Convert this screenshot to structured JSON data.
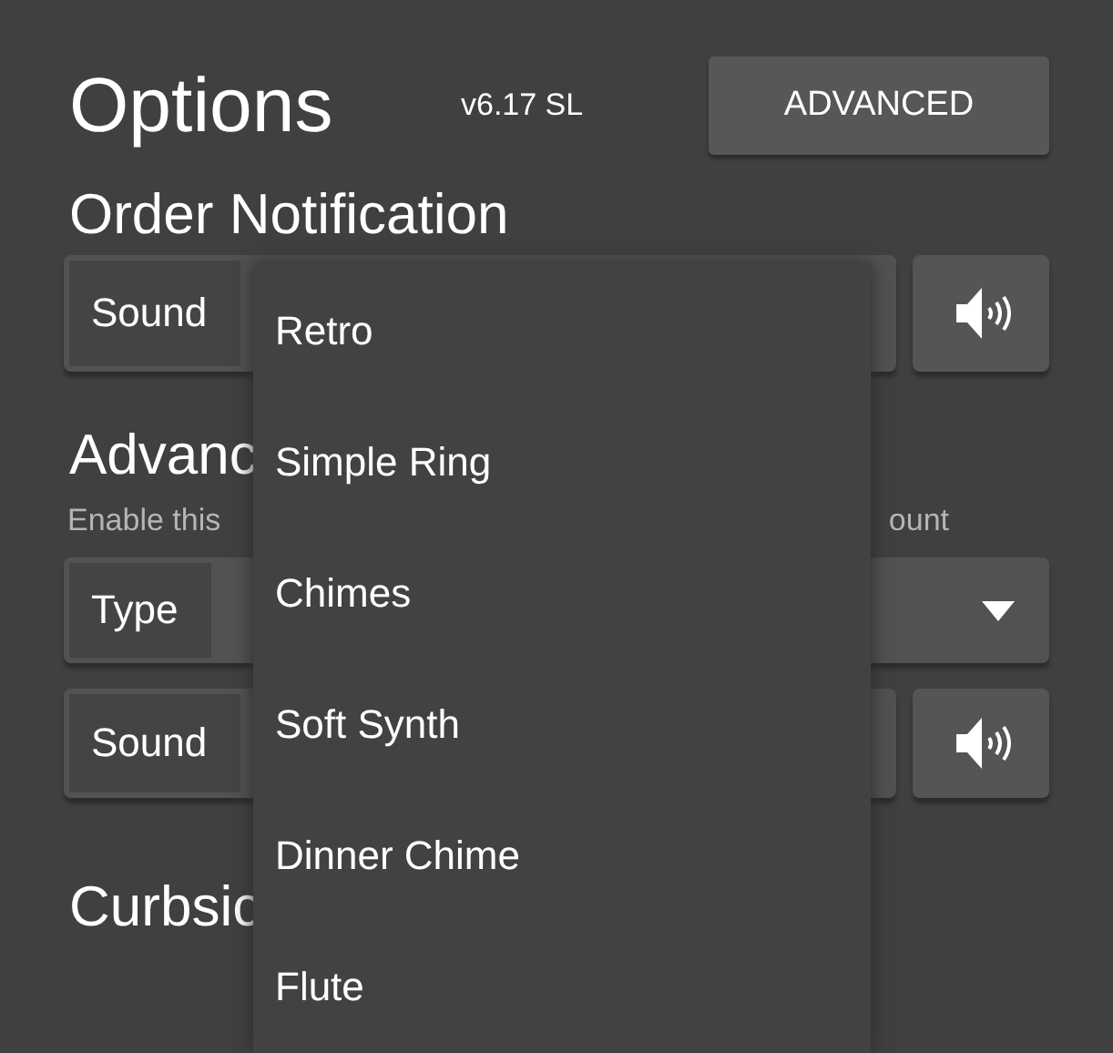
{
  "header": {
    "title": "Options",
    "version": "v6.17 SL",
    "button": "ADVANCED"
  },
  "sections": [
    {
      "heading": "Order Notification",
      "rows": [
        {
          "kind": "sound",
          "label": "Sound"
        }
      ]
    },
    {
      "heading": "Advanc",
      "description_start": "Enable this",
      "description_end": "ount",
      "rows": [
        {
          "kind": "select",
          "label": "Type"
        },
        {
          "kind": "sound",
          "label": "Sound"
        }
      ]
    },
    {
      "heading": "Curbsic"
    }
  ],
  "menu": {
    "items": [
      {
        "label": "Retro"
      },
      {
        "label": "Simple Ring"
      },
      {
        "label": "Chimes"
      },
      {
        "label": "Soft Synth"
      },
      {
        "label": "Dinner Chime"
      },
      {
        "label": "Flute"
      }
    ]
  }
}
